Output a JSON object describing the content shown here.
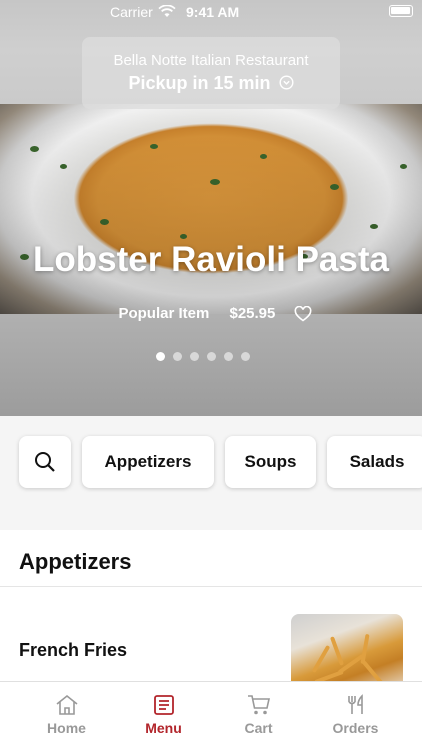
{
  "status_bar": {
    "carrier": "Carrier",
    "time": "9:41 AM"
  },
  "pickup": {
    "restaurant": "Bella Notte Italian Restaurant",
    "time_label": "Pickup in 15 min"
  },
  "hero": {
    "title": "Lobster Ravioli Pasta",
    "tag": "Popular Item",
    "price": "$25.95",
    "page_count": 6,
    "active_page": 1
  },
  "categories": [
    {
      "label": "Appetizers"
    },
    {
      "label": "Soups"
    },
    {
      "label": "Salads"
    }
  ],
  "section": {
    "title": "Appetizers"
  },
  "items": [
    {
      "name": "French Fries"
    }
  ],
  "tabs": [
    {
      "label": "Home",
      "icon": "home-icon",
      "active": false
    },
    {
      "label": "Menu",
      "icon": "menu-icon",
      "active": true
    },
    {
      "label": "Cart",
      "icon": "cart-icon",
      "active": false
    },
    {
      "label": "Orders",
      "icon": "orders-icon",
      "active": false
    }
  ],
  "colors": {
    "accent": "#b2252b",
    "inactive": "#999999"
  }
}
